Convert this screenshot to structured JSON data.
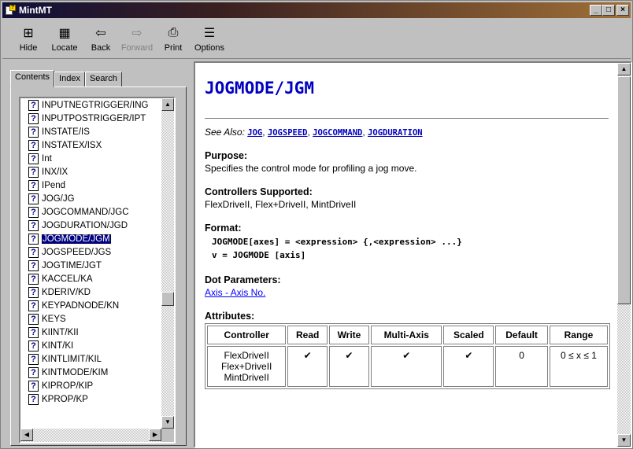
{
  "window": {
    "title": "MintMT",
    "min": "_",
    "max": "□",
    "close": "×"
  },
  "toolbar": [
    {
      "label": "Hide",
      "icon": "hide-icon",
      "glyph": "⊞",
      "disabled": false
    },
    {
      "label": "Locate",
      "icon": "locate-icon",
      "glyph": "▦",
      "disabled": false
    },
    {
      "label": "Back",
      "icon": "back-arrow-icon",
      "glyph": "⇦",
      "disabled": false
    },
    {
      "label": "Forward",
      "icon": "forward-arrow-icon",
      "glyph": "⇨",
      "disabled": true
    },
    {
      "label": "Print",
      "icon": "printer-icon",
      "glyph": "⎙",
      "disabled": false
    },
    {
      "label": "Options",
      "icon": "options-icon",
      "glyph": "☰",
      "disabled": false
    }
  ],
  "tabs": [
    "Contents",
    "Index",
    "Search"
  ],
  "list": [
    "INPUTNEGTRIGGER/ING",
    "INPUTPOSTRIGGER/IPT",
    "INSTATE/IS",
    "INSTATEX/ISX",
    "Int",
    "INX/IX",
    "IPend",
    "JOG/JG",
    "JOGCOMMAND/JGC",
    "JOGDURATION/JGD",
    "JOGMODE/JGM",
    "JOGSPEED/JGS",
    "JOGTIME/JGT",
    "KACCEL/KA",
    "KDERIV/KD",
    "KEYPADNODE/KN",
    "KEYS",
    "KIINT/KII",
    "KINT/KI",
    "KINTLIMIT/KIL",
    "KINTMODE/KIM",
    "KIPROP/KIP",
    "KPROP/KP"
  ],
  "selected_index": 10,
  "content": {
    "heading": "JOGMODE/JGM",
    "see_also_label": "See Also:",
    "see_also": [
      "JOG",
      "JOGSPEED",
      "JOGCOMMAND",
      "JOGDURATION"
    ],
    "purpose_h": "Purpose:",
    "purpose": "Specifies the control mode for profiling a jog move.",
    "controllers_h": "Controllers Supported:",
    "controllers": "FlexDriveII, Flex+DriveII, MintDriveII",
    "format_h": "Format:",
    "format_1": "JOGMODE[axes] = <expression> {,<expression> ...}",
    "format_2": "v = JOGMODE [axis]",
    "dot_h": "Dot Parameters:",
    "dot_link": "Axis - Axis No.",
    "attributes_h": "Attributes:",
    "table_headers": [
      "Controller",
      "Read",
      "Write",
      "Multi-Axis",
      "Scaled",
      "Default",
      "Range"
    ],
    "table_row": {
      "controller": [
        "FlexDriveII",
        "Flex+DriveII",
        "MintDriveII"
      ],
      "read": "✔",
      "write": "✔",
      "multi": "✔",
      "scaled": "✔",
      "default": "0",
      "range": "0 ≤ x ≤ 1"
    }
  }
}
